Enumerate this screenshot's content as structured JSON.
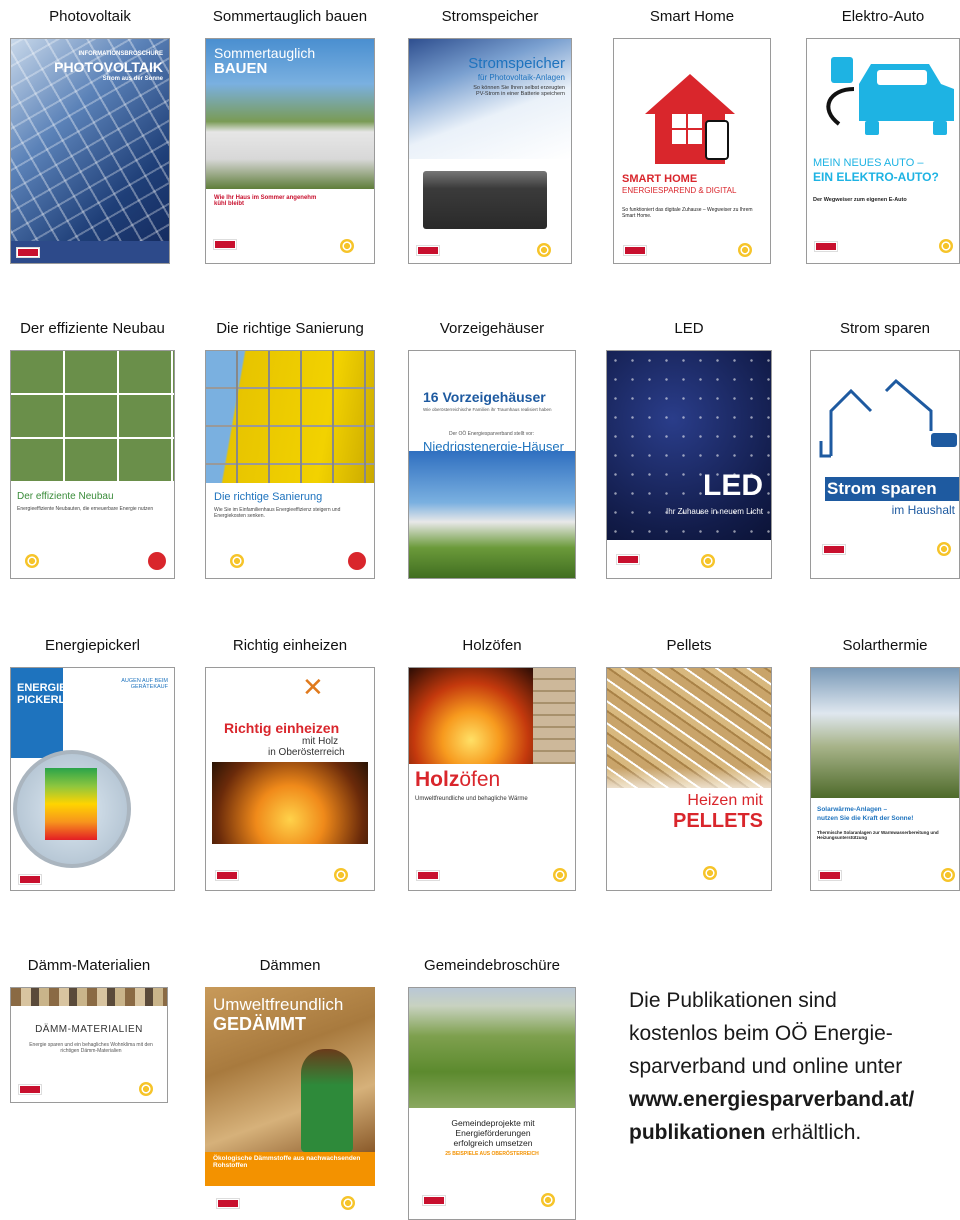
{
  "colors": {
    "accent_red": "#c8102e",
    "sun_yellow": "#f6c42a",
    "blue": "#1e5aa0"
  },
  "publications": [
    {
      "id": "pv",
      "title": "Photovoltaik",
      "cover": {
        "kicker": "INFORMATIONSBROSCHÜRE",
        "headline": "PHOTOVOLTAIK",
        "sub": "Strom aus der Sonne"
      }
    },
    {
      "id": "sommer",
      "title": "Sommertauglich bauen",
      "cover": {
        "headline1": "Sommertauglich",
        "headline2": "BAUEN",
        "sub": "Wie Ihr Haus im Sommer angenehm kühl bleibt"
      }
    },
    {
      "id": "speicher",
      "title": "Stromspeicher",
      "cover": {
        "headline": "Stromspeicher",
        "sub": "für Photovoltaik-Anlagen",
        "body": "So können Sie Ihren selbst erzeugten PV-Strom in einer Batterie speichern"
      }
    },
    {
      "id": "smart",
      "title": "Smart Home",
      "cover": {
        "headline": "SMART HOME",
        "sub": "ENERGIESPAREND & DIGITAL",
        "body": "So funktioniert das digitale Zuhause – Wegweiser zu Ihrem Smart Home."
      }
    },
    {
      "id": "auto",
      "title": "Elektro-Auto",
      "cover": {
        "headline1": "MEIN NEUES AUTO –",
        "headline2": "EIN ELEKTRO-AUTO?",
        "body": "Der Wegweiser zum eigenen E-Auto"
      }
    },
    {
      "id": "neubau",
      "title": "Der effiziente Neubau",
      "cover": {
        "headline": "Der effiziente Neubau",
        "body": "Energieeffiziente Neubauten, die erneuerbare Energie nutzen"
      }
    },
    {
      "id": "sanierung",
      "title": "Die richtige Sanierung",
      "cover": {
        "headline": "Die richtige Sanierung",
        "body": "Wie Sie im Einfamilienhaus Energieeffizienz steigern und Energiekosten senken."
      }
    },
    {
      "id": "vorzeige",
      "title": "Vorzeigehäuser",
      "cover": {
        "headline": "16 Vorzeigehäuser",
        "sub": "Wie oberösterreichische Familien ihr Traumhaus realisiert haben",
        "line": "Der OÖ Energiesparverband stellt vor:",
        "big": "Niedrigstenergie-Häuser"
      }
    },
    {
      "id": "led",
      "title": "LED",
      "cover": {
        "headline": "LED",
        "sub": "Ihr Zuhause in neuem Licht"
      }
    },
    {
      "id": "stromsparen",
      "title": "Strom sparen",
      "cover": {
        "headline": "Strom sparen",
        "sub": "im Haushalt"
      }
    },
    {
      "id": "pickerl",
      "title": "Energiepickerl",
      "cover": {
        "headline1": "ENERGIE",
        "headline2": "PICKERL",
        "sub": "AUGEN AUF BEIM GERÄTEKAUF"
      }
    },
    {
      "id": "einheizen",
      "title": "Richtig einheizen",
      "cover": {
        "headline": "Richtig einheizen",
        "sub1": "mit Holz",
        "sub2": "in Oberösterreich"
      }
    },
    {
      "id": "holz",
      "title": "Holzöfen",
      "cover": {
        "headline_bold": "Holz",
        "headline_rest": "öfen",
        "sub": "Umweltfreundliche und behagliche Wärme"
      }
    },
    {
      "id": "pellets",
      "title": "Pellets",
      "cover": {
        "headline1": "Heizen mit",
        "headline2": "PELLETS"
      }
    },
    {
      "id": "solar",
      "title": "Solarthermie",
      "cover": {
        "headline1": "Solarwärme-Anlagen –",
        "headline2": "nutzen Sie die Kraft der Sonne!",
        "body": "Thermische Solaranlagen zur Warmwasserbereitung und Heizungsunterstützung"
      }
    },
    {
      "id": "daemmmat",
      "title": "Dämm-Materialien",
      "cover": {
        "headline": "DÄMM-MATERIALIEN",
        "body": "Energie sparen und ein behagliches Wohnklima mit den richtigen Dämm-Materialien"
      }
    },
    {
      "id": "daemmen",
      "title": "Dämmen",
      "cover": {
        "headline1": "Umweltfreundlich",
        "headline2": "GEDÄMMT",
        "sub": "Ökologische Dämmstoffe aus nachwachsenden Rohstoffen"
      }
    },
    {
      "id": "gemeinde",
      "title": "Gemeindebroschüre",
      "cover": {
        "headline": "Gemeindeprojekte mit Energieförderungen erfolgreich umsetzen",
        "sub": "25 BEISPIELE AUS OBERÖSTERREICH"
      }
    }
  ],
  "note": {
    "line1": "Die Publikationen sind",
    "line2": "kostenlos beim OÖ Energie-",
    "line3": "sparverband und online unter",
    "link1": "www.energiesparverband.at/",
    "link2": "publikationen",
    "tail": " erhältlich."
  }
}
